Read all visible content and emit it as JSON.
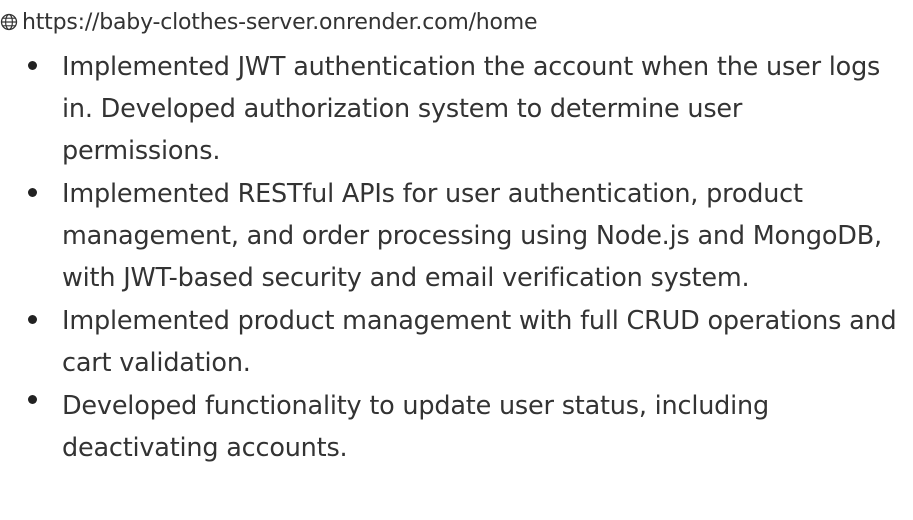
{
  "link": {
    "icon": "globe-icon",
    "url": "https://baby-clothes-server.onrender.com/home"
  },
  "bullets": [
    {
      "text": "Implemented JWT authentication the account when the user logs in. Developed authorization system to determine user permissions."
    },
    {
      "text": "Implemented RESTful APIs for user authentication, product management, and order processing using Node.js and MongoDB, with JWT-based security and email verification system."
    },
    {
      "text": "Implemented product management with full CRUD operations and cart validation."
    },
    {
      "text": "Developed functionality to update user status, including deactivating accounts."
    }
  ]
}
